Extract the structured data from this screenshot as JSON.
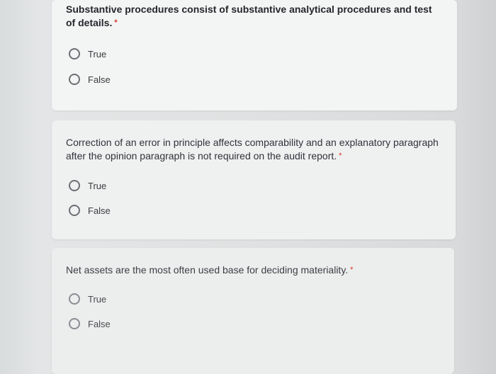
{
  "questions": [
    {
      "text": "Substantive procedures consist of substantive analytical procedures and test of details.",
      "required_mark": "*",
      "options": [
        "True",
        "False"
      ]
    },
    {
      "text": "Correction of an error in principle affects comparability and an explanatory paragraph after the opinion paragraph is not required on the audit report.",
      "required_mark": "*",
      "options": [
        "True",
        "False"
      ]
    },
    {
      "text": "Net assets are the most often used base for deciding materiality.",
      "required_mark": "*",
      "options": [
        "True",
        "False"
      ]
    }
  ],
  "colors": {
    "required": "#d93025",
    "card": "#f1f2f2",
    "radio_border": "#6b6f73"
  },
  "icons": {
    "radio": "radio-unchecked-icon"
  }
}
